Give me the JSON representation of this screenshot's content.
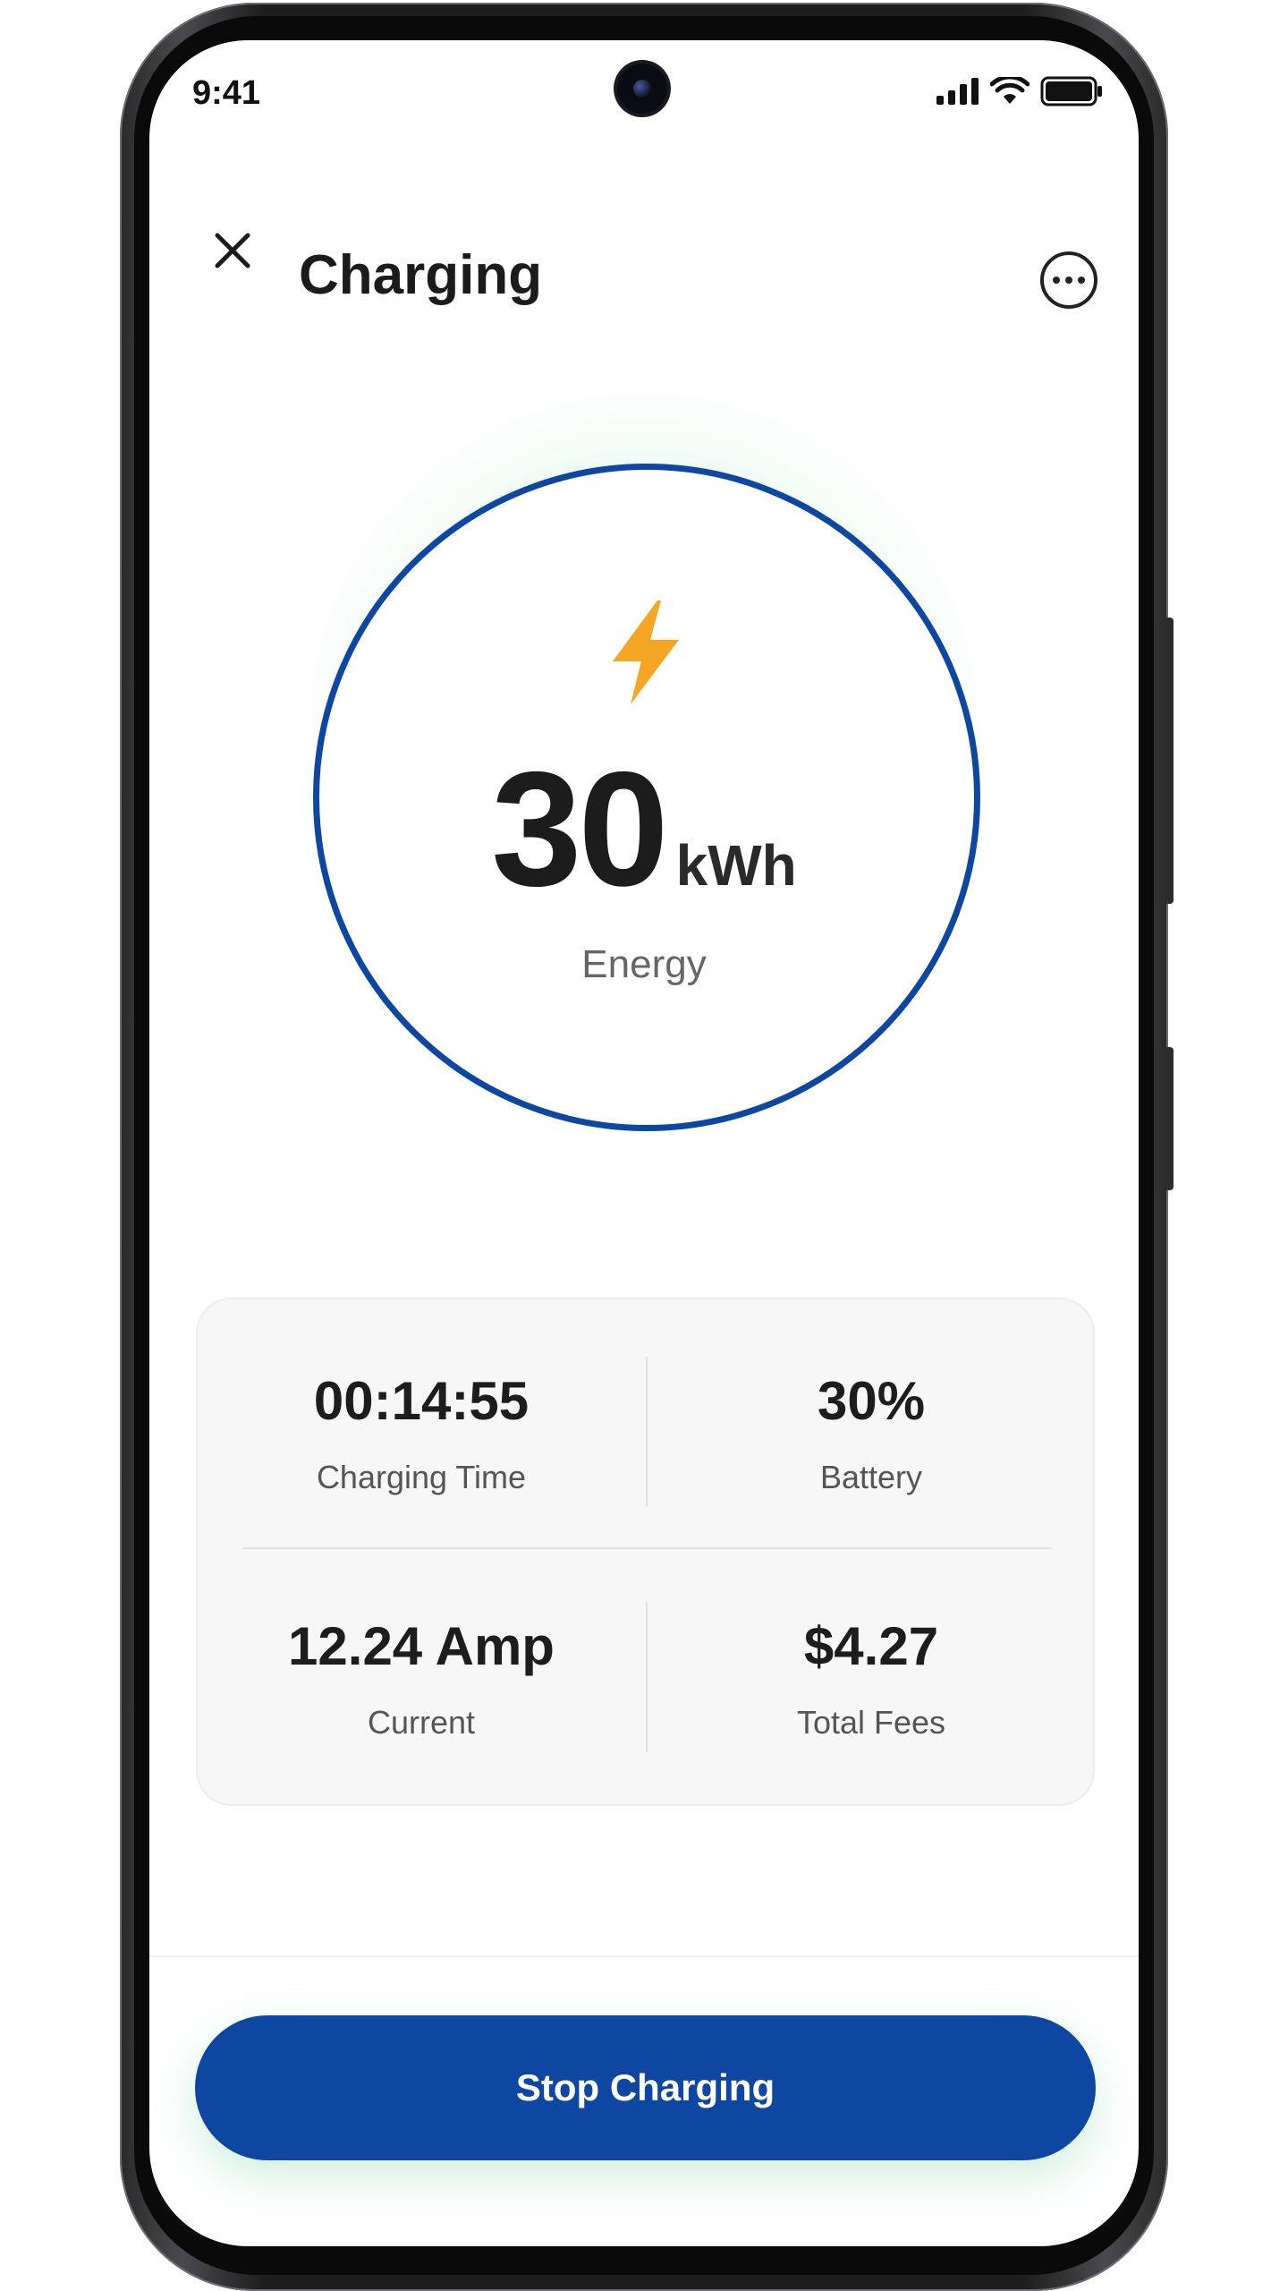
{
  "status_bar": {
    "time": "9:41",
    "icons": [
      "signal-icon",
      "wifi-icon",
      "battery-icon"
    ]
  },
  "header": {
    "title": "Charging",
    "close_icon": "close-icon",
    "more_icon": "more-options-icon"
  },
  "energy": {
    "value": "30",
    "unit": "kWh",
    "label": "Energy",
    "icon": "lightning-bolt-icon"
  },
  "stats": [
    {
      "value": "00:14:55",
      "label": "Charging Time"
    },
    {
      "value": "30%",
      "label": "Battery"
    },
    {
      "value": "12.24 Amp",
      "label": "Current"
    },
    {
      "value": "$4.27",
      "label": "Total Fees"
    }
  ],
  "actions": {
    "stop_label": "Stop Charging"
  },
  "colors": {
    "primary": "#0d47a1",
    "bolt": "#f5a623",
    "glow": "#78d2a0",
    "text": "#1c1c1c",
    "muted": "#666666"
  }
}
